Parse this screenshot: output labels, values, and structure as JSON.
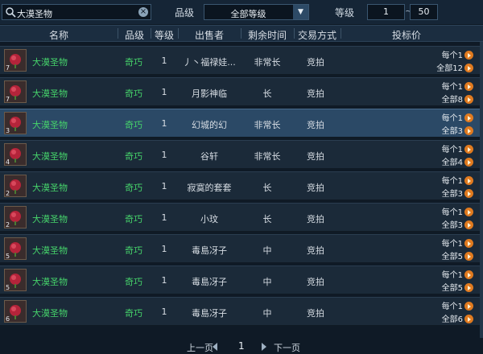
{
  "search": {
    "value": "大漠圣物",
    "icon": "search-icon",
    "clear_icon": "close-icon"
  },
  "filters": {
    "grade_label": "品级",
    "grade_selected": "全部等级",
    "level_label": "等级",
    "level_min": "1",
    "level_separator": "~",
    "level_max": "50"
  },
  "columns": {
    "name": "名称",
    "quality": "品级",
    "level": "等级",
    "seller": "出售者",
    "time": "剩余时间",
    "trade": "交易方式",
    "price": "投标价"
  },
  "rows": [
    {
      "count": "7",
      "name": "大漠圣物",
      "quality": "奇巧",
      "level": "1",
      "seller": "丿丶福禄娃...",
      "time": "非常长",
      "trade": "竞拍",
      "price_each": "每个1",
      "price_total": "全部12"
    },
    {
      "count": "7",
      "name": "大漠圣物",
      "quality": "奇巧",
      "level": "1",
      "seller": "月影神临",
      "time": "长",
      "trade": "竞拍",
      "price_each": "每个1",
      "price_total": "全部8"
    },
    {
      "count": "3",
      "name": "大漠圣物",
      "quality": "奇巧",
      "level": "1",
      "seller": "幻城的幻",
      "time": "非常长",
      "trade": "竞拍",
      "price_each": "每个1",
      "price_total": "全部3"
    },
    {
      "count": "4",
      "name": "大漠圣物",
      "quality": "奇巧",
      "level": "1",
      "seller": "谷轩",
      "time": "非常长",
      "trade": "竞拍",
      "price_each": "每个1",
      "price_total": "全部4"
    },
    {
      "count": "2",
      "name": "大漠圣物",
      "quality": "奇巧",
      "level": "1",
      "seller": "寂寞的套套",
      "time": "长",
      "trade": "竞拍",
      "price_each": "每个1",
      "price_total": "全部3"
    },
    {
      "count": "2",
      "name": "大漠圣物",
      "quality": "奇巧",
      "level": "1",
      "seller": "小玟",
      "time": "长",
      "trade": "竞拍",
      "price_each": "每个1",
      "price_total": "全部3"
    },
    {
      "count": "5",
      "name": "大漠圣物",
      "quality": "奇巧",
      "level": "1",
      "seller": "毒島冴子",
      "time": "中",
      "trade": "竞拍",
      "price_each": "每个1",
      "price_total": "全部5"
    },
    {
      "count": "5",
      "name": "大漠圣物",
      "quality": "奇巧",
      "level": "1",
      "seller": "毒島冴子",
      "time": "中",
      "trade": "竞拍",
      "price_each": "每个1",
      "price_total": "全部5"
    },
    {
      "count": "6",
      "name": "大漠圣物",
      "quality": "奇巧",
      "level": "1",
      "seller": "毒島冴子",
      "time": "中",
      "trade": "竞拍",
      "price_each": "每个1",
      "price_total": "全部6"
    }
  ],
  "pager": {
    "prev": "上一页",
    "page": "1",
    "next": "下一页"
  },
  "colors": {
    "background": "#0f1a26",
    "row": "#1b2a39",
    "selected_row": "#2b4966",
    "quality_green": "#46d46b",
    "coin": "#e07a1f"
  }
}
